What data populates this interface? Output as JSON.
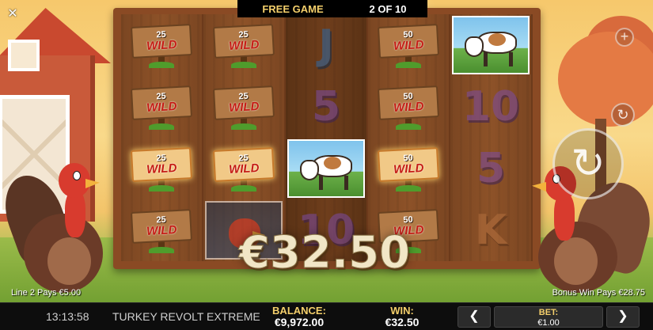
{
  "banner": {
    "mode": "FREE GAME",
    "counter": "2 OF 10"
  },
  "reels": [
    [
      {
        "type": "wild",
        "value": "25",
        "label": "WILD",
        "lit": false
      },
      {
        "type": "wild",
        "value": "25",
        "label": "WILD",
        "lit": false
      },
      {
        "type": "wild",
        "value": "25",
        "label": "WILD",
        "lit": true
      },
      {
        "type": "wild",
        "value": "25",
        "label": "WILD",
        "lit": false
      }
    ],
    [
      {
        "type": "wild",
        "value": "25",
        "label": "WILD",
        "lit": false
      },
      {
        "type": "wild",
        "value": "25",
        "label": "WILD",
        "lit": false
      },
      {
        "type": "wild",
        "value": "25",
        "label": "WILD",
        "lit": true
      },
      {
        "type": "picture",
        "icon": "rooster-icon"
      }
    ],
    [
      {
        "type": "letter",
        "text": "J",
        "color": "blue"
      },
      {
        "type": "letter",
        "text": "5",
        "color": "purple"
      },
      {
        "type": "picture",
        "icon": "cow-icon"
      },
      {
        "type": "letter",
        "text": "10",
        "color": "purple"
      }
    ],
    [
      {
        "type": "wild",
        "value": "50",
        "label": "WILD",
        "lit": false
      },
      {
        "type": "wild",
        "value": "50",
        "label": "WILD",
        "lit": false
      },
      {
        "type": "wild",
        "value": "50",
        "label": "WILD",
        "lit": true
      },
      {
        "type": "wild",
        "value": "50",
        "label": "WILD",
        "lit": false
      }
    ],
    [
      {
        "type": "picture",
        "icon": "cow-icon"
      },
      {
        "type": "letter",
        "text": "10",
        "color": "purple"
      },
      {
        "type": "letter",
        "text": "5",
        "color": "purple"
      },
      {
        "type": "letter",
        "text": "K",
        "color": "brown"
      }
    ]
  ],
  "win_amount": "€32.50",
  "line_pays": "Line 2 Pays €5.00",
  "bonus_pays": "Bonus Win Pays €28.75",
  "controls": {
    "close": "✕",
    "plus": "+",
    "autoplay": "↻",
    "spin": "↻"
  },
  "bottom_bar": {
    "clock": "13:13:58",
    "game_name": "TURKEY REVOLT EXTREME",
    "balance_label": "BALANCE:",
    "balance_value": "€9,972.00",
    "win_label": "WIN:",
    "win_value": "€32.50",
    "prev": "❮",
    "bet_label": "BET:",
    "bet_value": "€1.00",
    "next": "❯"
  },
  "colors": {
    "accent_gold": "#f4cf6b",
    "frame_wood": "#8a4a24",
    "wild_red": "#c51c14"
  }
}
